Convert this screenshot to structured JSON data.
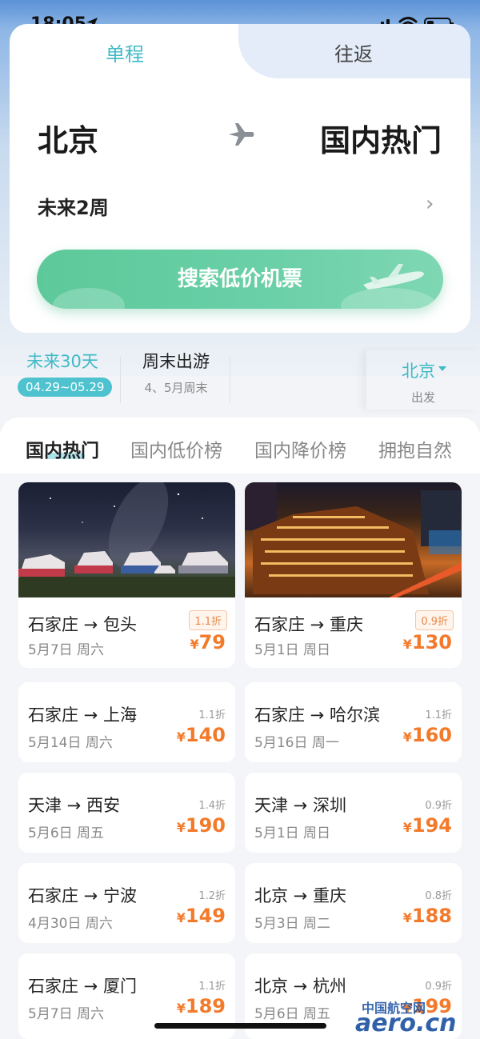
{
  "status_bar": {
    "time": "18:05"
  },
  "booking": {
    "tabs": [
      "单程",
      "往返"
    ],
    "from_city": "北京",
    "to_city": "国内热门",
    "date_range": "未来2周",
    "search_label": "搜索低价机票"
  },
  "filters": {
    "next30": {
      "label": "未来30天",
      "range": "04.29~05.29"
    },
    "weekend": {
      "label": "周末出游",
      "sub": "4、5月周末"
    },
    "origin": {
      "city": "北京",
      "sub": "出发"
    }
  },
  "categories": [
    "国内热门",
    "国内低价榜",
    "国内降价榜",
    "拥抱自然"
  ],
  "deals": [
    {
      "route": "石家庄 → 包头",
      "date": "5月7日 周六",
      "discount": "1.1折",
      "price": "79"
    },
    {
      "route": "石家庄 → 重庆",
      "date": "5月1日 周日",
      "discount": "0.9折",
      "price": "130"
    },
    {
      "route": "石家庄 → 上海",
      "date": "5月14日 周六",
      "discount": "1.1折",
      "price": "140"
    },
    {
      "route": "石家庄 → 哈尔滨",
      "date": "5月16日 周一",
      "discount": "1.1折",
      "price": "160"
    },
    {
      "route": "天津 → 西安",
      "date": "5月6日 周五",
      "discount": "1.4折",
      "price": "190"
    },
    {
      "route": "天津 → 深圳",
      "date": "5月1日 周日",
      "discount": "0.9折",
      "price": "194"
    },
    {
      "route": "石家庄 → 宁波",
      "date": "4月30日 周六",
      "discount": "1.2折",
      "price": "149"
    },
    {
      "route": "北京 → 重庆",
      "date": "5月3日 周二",
      "discount": "0.8折",
      "price": "188"
    },
    {
      "route": "石家庄 → 厦门",
      "date": "5月7日 周六",
      "discount": "1.1折",
      "price": "189"
    },
    {
      "route": "北京 → 杭州",
      "date": "5月6日 周五",
      "discount": "0.9折",
      "price": "199"
    }
  ],
  "currency": "¥",
  "watermark": {
    "line1": "中国航空网",
    "line2": "aero.cn"
  },
  "colors": {
    "accent": "#3fbac6",
    "button": "#5dc99a",
    "price": "#f37a2a"
  }
}
